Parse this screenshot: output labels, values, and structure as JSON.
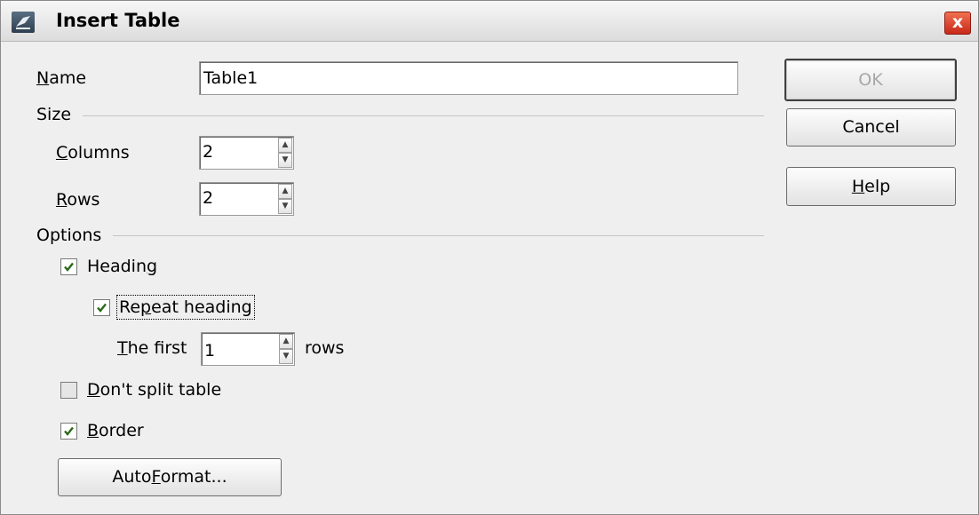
{
  "window": {
    "title": "Insert Table",
    "close_label": "x"
  },
  "name": {
    "label_key": "N",
    "label_rest": "ame",
    "value": "Table1"
  },
  "size": {
    "heading": "Size",
    "columns": {
      "label_key": "C",
      "label_rest": "olumns",
      "value": "2"
    },
    "rows": {
      "label_key": "R",
      "label_rest": "ows",
      "value": "2"
    }
  },
  "options": {
    "heading": "Options",
    "heading_checkbox": {
      "label_pre": "Headin",
      "label_key": "g",
      "label_post": "",
      "checked": true
    },
    "repeat_heading": {
      "label_pre": "Re",
      "label_key": "p",
      "label_post": "eat heading",
      "checked": true
    },
    "the_first": {
      "label_key": "T",
      "label_rest": "he first",
      "value": "1",
      "suffix": "rows"
    },
    "dont_split": {
      "label_key": "D",
      "label_rest": "on't split table",
      "checked": false
    },
    "border": {
      "label_key": "B",
      "label_rest": "order",
      "checked": true
    },
    "autoformat": {
      "label_pre": "Auto",
      "label_key": "F",
      "label_post": "ormat..."
    }
  },
  "buttons": {
    "ok": "OK",
    "cancel": "Cancel",
    "help_key": "H",
    "help_rest": "elp"
  }
}
